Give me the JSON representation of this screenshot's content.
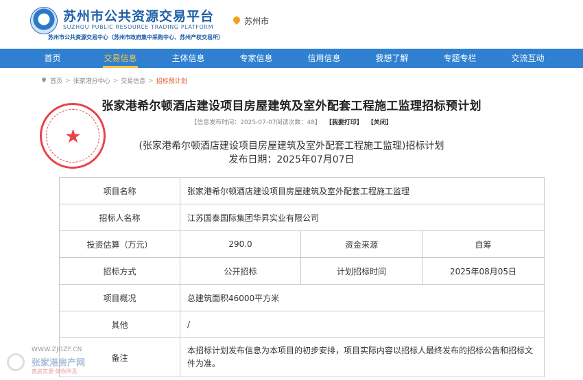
{
  "header": {
    "logo_title": "苏州市公共资源交易平台",
    "logo_en": "SUZHOU PUBLIC RESOURCE TRADING PLATFORM",
    "logo_sub": "苏州市公共资源交易中心（苏州市政府集中采购中心、苏州产权交易所）",
    "location": "苏州市"
  },
  "nav": {
    "items": [
      "首页",
      "交易信息",
      "主体信息",
      "专家信息",
      "信用信息",
      "我想了解",
      "专题专栏",
      "交流互动"
    ],
    "active_index": 1
  },
  "breadcrumb": {
    "items": [
      "首页",
      "张家港分中心",
      "交易信息",
      "招标预计划"
    ]
  },
  "article": {
    "title": "张家港希尔顿酒店建设项目房屋建筑及室外配套工程施工监理招标预计划",
    "meta_text": "【信息发布时间：2025-07-07阅读次数：48】",
    "print_label": "【我要打印】",
    "close_label": "【关闭】",
    "sub_title": "(张家港希尔顿酒店建设项目房屋建筑及室外配套工程施工监理)招标计划",
    "pub_date": "发布日期：2025年07月07日"
  },
  "table": {
    "project_name_label": "项目名称",
    "project_name": "张家港希尔顿酒店建设项目房屋建筑及室外配套工程施工监理",
    "tenderer_label": "招标人名称",
    "tenderer": "江苏国泰国际集团华昇实业有限公司",
    "invest_label": "投资估算（万元）",
    "invest": "290.0",
    "fund_label": "资金来源",
    "fund": "自筹",
    "method_label": "招标方式",
    "method": "公开招标",
    "plan_time_label": "计划招标时间",
    "plan_time": "2025年08月05日",
    "overview_label": "项目概况",
    "overview": "总建筑面积46000平方米",
    "other_label": "其他",
    "other": "/",
    "remark_label": "备注",
    "remark": "本招标计划发布信息为本项目的初步安排，项目实际内容以招标人最终发布的招标公告和招标文件为准。"
  },
  "watermark": {
    "url": "WWW.ZJGZF.CN",
    "name": "张家港房产网",
    "slogan": "真房实景·如你所见"
  },
  "colors": {
    "nav_bg": "#2f80d0",
    "nav_active": "#f5c542",
    "breadcrumb_current": "#e2562a",
    "seal": "#e8323c"
  }
}
